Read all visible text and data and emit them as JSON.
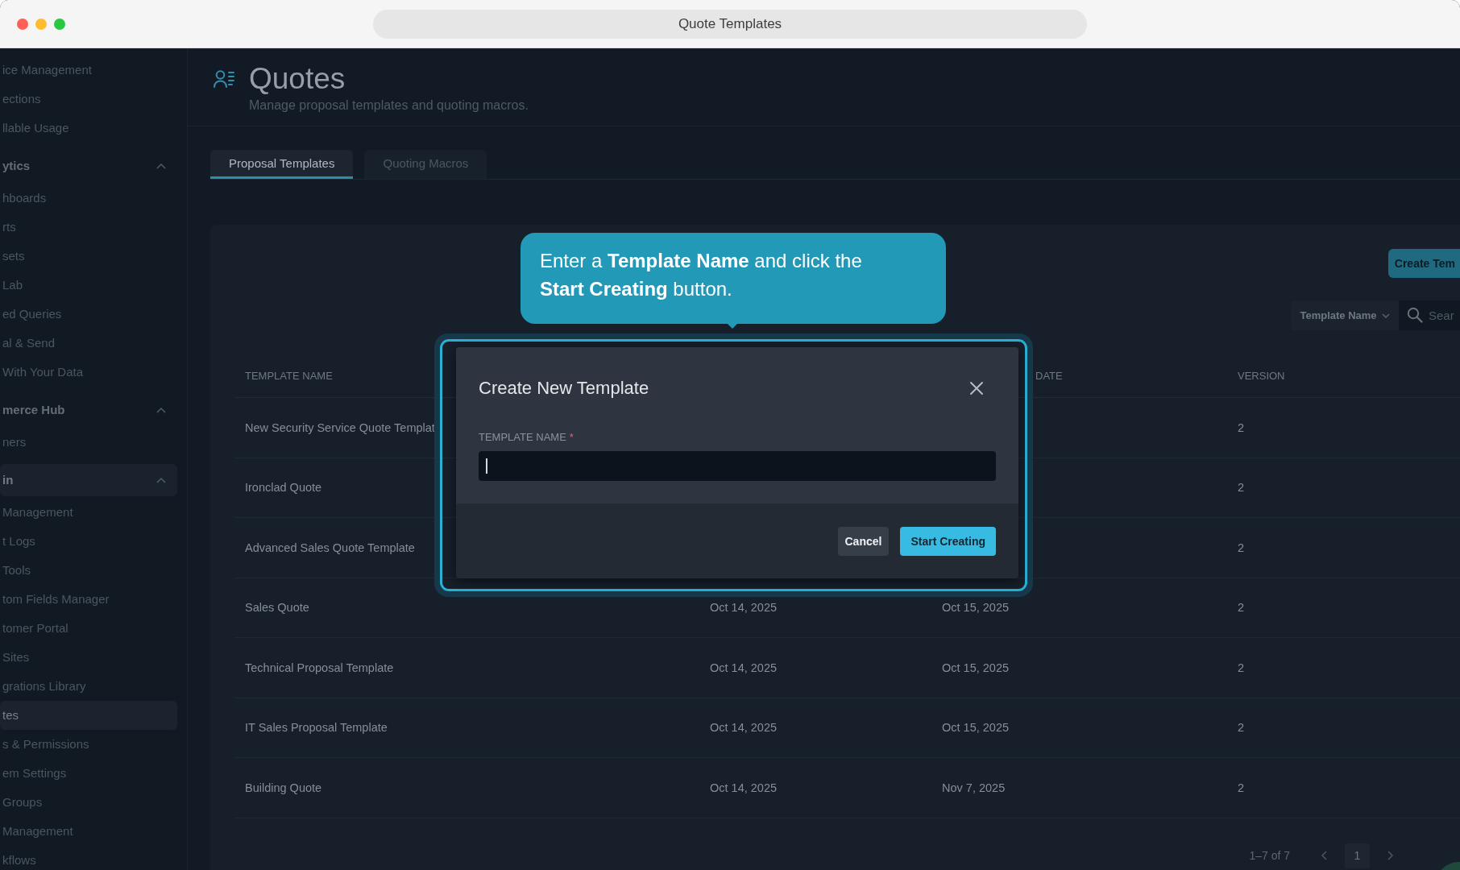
{
  "window": {
    "title": "Quote Templates"
  },
  "sidebar": {
    "items": [
      {
        "kind": "link",
        "label": "ice Management",
        "selected": false
      },
      {
        "kind": "link",
        "label": "ections",
        "selected": false
      },
      {
        "kind": "link",
        "label": "llable Usage",
        "selected": false
      },
      {
        "kind": "group",
        "label": "ytics",
        "selected": false,
        "expanded": true,
        "children": [
          {
            "label": "hboards",
            "selected": false
          },
          {
            "label": "rts",
            "selected": false
          },
          {
            "label": "sets",
            "selected": false
          },
          {
            "label": "Lab",
            "selected": false
          },
          {
            "label": "ed Queries",
            "selected": false
          },
          {
            "label": "al & Send",
            "selected": false
          },
          {
            "label": "With Your Data",
            "selected": false
          }
        ]
      },
      {
        "kind": "group",
        "label": "merce Hub",
        "selected": false,
        "expanded": true,
        "children": [
          {
            "label": "ners",
            "selected": false
          }
        ]
      },
      {
        "kind": "group",
        "label": "in",
        "selected": true,
        "expanded": true,
        "children": [
          {
            "label": "Management",
            "selected": false
          },
          {
            "label": "t Logs",
            "selected": false
          },
          {
            "label": "Tools",
            "selected": false
          },
          {
            "label": "tom Fields Manager",
            "selected": false
          },
          {
            "label": "tomer Portal",
            "selected": false
          },
          {
            "label": "Sites",
            "selected": false
          },
          {
            "label": "grations Library",
            "selected": false
          },
          {
            "label": "tes",
            "selected": true
          },
          {
            "label": "s & Permissions",
            "selected": false
          },
          {
            "label": "em Settings",
            "selected": false
          },
          {
            "label": "Groups",
            "selected": false
          },
          {
            "label": "Management",
            "selected": false
          },
          {
            "label": "kflows",
            "selected": false
          }
        ]
      }
    ]
  },
  "header": {
    "title": "Quotes",
    "subtitle": "Manage proposal templates and quoting macros."
  },
  "tabs": [
    {
      "label": "Proposal Templates",
      "selected": true
    },
    {
      "label": "Quoting Macros",
      "selected": false
    }
  ],
  "toolbar": {
    "create_button": "Create Tem",
    "filter": "Template Name",
    "search": {
      "placeholder": "Sear"
    }
  },
  "table": {
    "columns": {
      "column_1": "TEMPLATE NAME",
      "column_3": "DATE",
      "column_4": "VERSION"
    },
    "rows": [
      {
        "column_1": "New Security Service Quote Templat",
        "column_4": "2"
      },
      {
        "column_1": "Ironclad Quote",
        "column_4": "2"
      },
      {
        "column_1": "Advanced Sales Quote Template",
        "column_4": "2"
      },
      {
        "column_1": "Sales Quote",
        "column_2": "Oct 14, 2025",
        "column_3": "Oct 15, 2025",
        "column_4": "2"
      },
      {
        "column_1": "Technical Proposal Template",
        "column_2": "Oct 14, 2025",
        "column_3": "Oct 15, 2025",
        "column_4": "2"
      },
      {
        "column_1": "IT Sales Proposal Template",
        "column_2": "Oct 14, 2025",
        "column_3": "Oct 15, 2025",
        "column_4": "2"
      },
      {
        "column_1": "Building Quote",
        "column_2": "Oct 14, 2025",
        "column_3": "Nov 7, 2025",
        "column_4": "2"
      }
    ]
  },
  "pagination": {
    "range": "1–7 of 7",
    "pages": [
      {
        "label": "1",
        "selected": true
      }
    ]
  },
  "modal": {
    "title": "Create New Template",
    "field": {
      "label": "TEMPLATE NAME",
      "required_mark": "*",
      "focused": true
    },
    "buttons": [
      {
        "kind": "secondary",
        "label": "Cancel"
      },
      {
        "kind": "primary",
        "label": "Start Creating"
      }
    ]
  },
  "callout": {
    "text": "Enter a **Template Name** and click the **Start Creating** button."
  }
}
